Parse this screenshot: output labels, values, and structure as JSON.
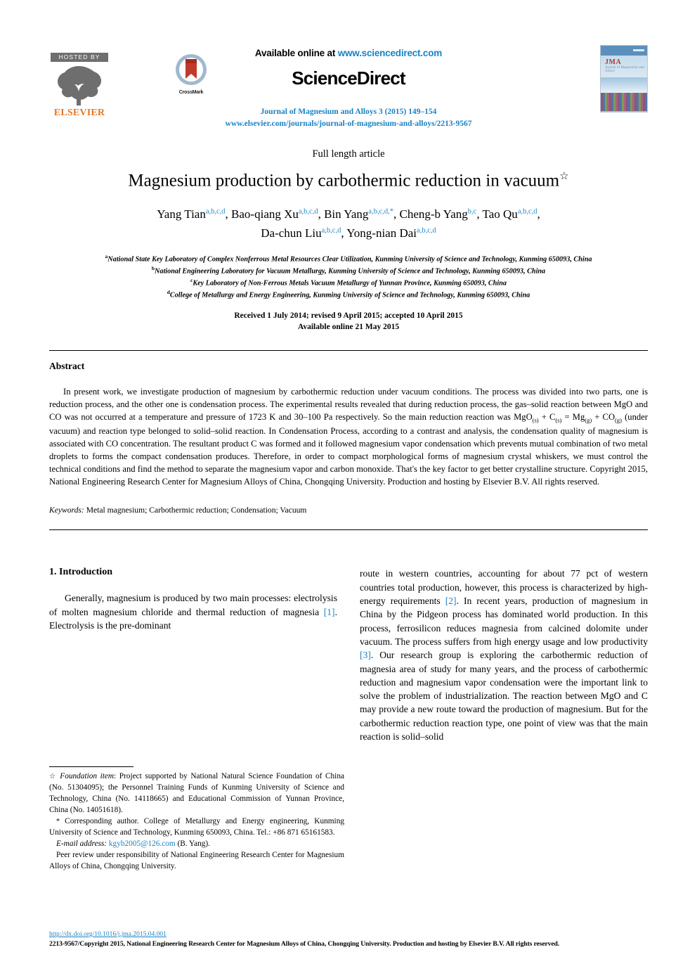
{
  "header": {
    "hosted_by_label": "HOSTED BY",
    "elsevier_wordmark": "ELSEVIER",
    "crossmark_label": "CrossMark",
    "available_prefix": "Available online at ",
    "available_url": "www.sciencedirect.com",
    "sciencedirect_wordmark": "ScienceDirect",
    "journal_citation": "Journal of Magnesium and Alloys 3 (2015) 149–154",
    "journal_url": "www.elsevier.com/journals/journal-of-magnesium-and-alloys/2213-9567",
    "cover_journal_abbrev": "JMA",
    "cover_journal_sub": "Journal of Magnesium and Alloys"
  },
  "article": {
    "type": "Full length article",
    "title": "Magnesium production by carbothermic reduction in vacuum",
    "title_footnote_mark": "☆",
    "authors": [
      {
        "name": "Yang Tian",
        "affs": "a,b,c,d",
        "corresponding": false,
        "sep": ", "
      },
      {
        "name": "Bao-qiang Xu",
        "affs": "a,b,c,d",
        "corresponding": false,
        "sep": ", "
      },
      {
        "name": "Bin Yang",
        "affs": "a,b,c,d,",
        "corresponding": true,
        "sep": ", "
      },
      {
        "name": "Cheng-b Yang",
        "affs": "b,c",
        "corresponding": false,
        "sep": ", "
      },
      {
        "name": "Tao Qu",
        "affs": "a,b,c,d",
        "corresponding": false,
        "sep": ", "
      },
      {
        "name": "Da-chun Liu",
        "affs": "a,b,c,d",
        "corresponding": false,
        "sep": ", "
      },
      {
        "name": "Yong-nian Dai",
        "affs": "a,b,c,d",
        "corresponding": false,
        "sep": ""
      }
    ],
    "corresponding_symbol": "*",
    "affiliations": [
      {
        "mark": "a",
        "text": "National State Key Laboratory of Complex Nonferrous Metal Resources Clear Utilization, Kunming University of Science and Technology, Kunming 650093, China"
      },
      {
        "mark": "b",
        "text": "National Engineering Laboratory for Vacuum Metallurgy, Kunming University of Science and Technology, Kunming 650093, China"
      },
      {
        "mark": "c",
        "text": "Key Laboratory of Non-Ferrous Metals Vacuum Metallurgy of Yunnan Province, Kunming 650093, China"
      },
      {
        "mark": "d",
        "text": "College of Metallurgy and Energy Engineering, Kunming University of Science and Technology, Kunming 650093, China"
      }
    ],
    "received_line": "Received 1 July 2014; revised 9 April 2015; accepted 10 April 2015",
    "available_line": "Available online 21 May 2015"
  },
  "abstract": {
    "heading": "Abstract",
    "part1": "In present work, we investigate production of magnesium by carbothermic reduction under vacuum conditions. The process was divided into two parts, one is reduction process, and the other one is condensation process. The experimental results revealed that during reduction process, the gas–solid reaction between MgO and CO was not occurred at a temperature and pressure of 1723 K and 30–100 Pa respectively. So the main reduction reaction was MgO",
    "sub1": "(s)",
    "part2": " + C",
    "sub2": "(s)",
    "part3": " = Mg",
    "sub3": "(g)",
    "part4": " + CO",
    "sub4": "(g)",
    "part5": " (under vacuum) and reaction type belonged to solid–solid reaction. In Condensation Process, according to a contrast and analysis, the condensation quality of magnesium is associated with CO concentration. The resultant product C was formed and it followed magnesium vapor condensation which prevents mutual combination of two metal droplets to forms the compact condensation produces. Therefore, in order to compact morphological forms of magnesium crystal whiskers, we must control the technical conditions and find the method to separate the magnesium vapor and carbon monoxide. That's the key factor to get better crystalline structure. Copyright 2015, National Engineering Research Center for Magnesium Alloys of China, Chongqing University. Production and hosting by Elsevier B.V. All rights reserved.",
    "keywords_label": "Keywords:",
    "keywords_value": " Metal magnesium; Carbothermic reduction; Condensation; Vacuum"
  },
  "body": {
    "section_title": "1. Introduction",
    "left_paragraph_a": "Generally, magnesium is produced by two main processes: electrolysis of molten magnesium chloride and thermal reduction of magnesia ",
    "left_ref_1": "[1]",
    "left_paragraph_b": ". Electrolysis is the pre-dominant",
    "right_paragraph_a": "route in western countries, accounting for about 77 pct of western countries total production, however, this process is characterized by high-energy requirements ",
    "right_ref_2": "[2]",
    "right_paragraph_b": ". In recent years, production of magnesium in China by the Pidgeon process has dominated world production. In this process, ferrosilicon reduces magnesia from calcined dolomite under vacuum. The process suffers from high energy usage and low productivity ",
    "right_ref_3": "[3]",
    "right_paragraph_c": ". Our research group is exploring the carbothermic reduction of magnesia area of study for many years, and the process of carbothermic reduction and magnesium vapor condensation were the important link to solve the problem of industrialization. The reaction between MgO and C may provide a new route toward the production of magnesium. But for the carbothermic reduction reaction type, one point of view was that the main reaction is solid–solid"
  },
  "footnotes": {
    "star_mark": "☆",
    "foundation_label": "Foundation item",
    "foundation_text": ": Project supported by National Natural Science Foundation of China (No. 51304095); the Personnel Training Funds of Kunming University of Science and Technology, China (No. 14118665) and Educational Commission of Yunnan Province, China (No. 14051618).",
    "corr_mark": "*",
    "corr_text": " Corresponding author. College of Metallurgy and Energy engineering, Kunming University of Science and Technology, Kunming 650093, China. Tel.: +86 871 65161583.",
    "email_label": "E-mail address:",
    "email_value": "kgyb2005@126.com",
    "email_owner": " (B. Yang).",
    "peer_review": "Peer review under responsibility of National Engineering Research Center for Magnesium Alloys of China, Chongqing University."
  },
  "footer": {
    "doi": "http://dx.doi.org/10.1016/j.jma.2015.04.001",
    "copyright": "2213-9567/Copyright 2015, National Engineering Research Center for Magnesium Alloys of China, Chongqing University. Production and hosting by Elsevier B.V. All rights reserved."
  },
  "colors": {
    "link_blue": "#1a82c4",
    "elsevier_orange": "#E87722",
    "hosted_gray": "#6e6e6e"
  }
}
